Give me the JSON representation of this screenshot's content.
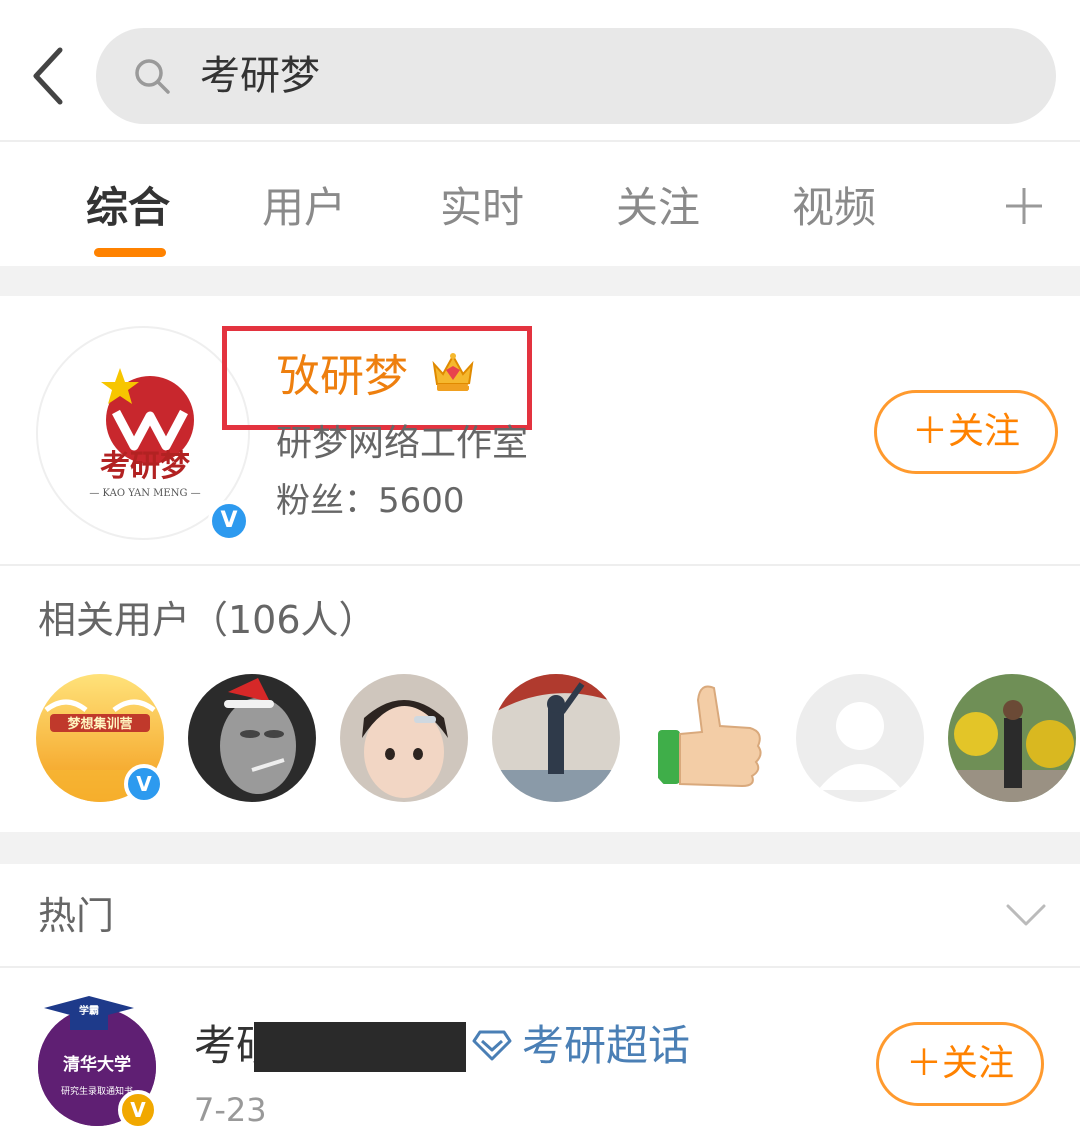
{
  "search": {
    "query": "考研梦"
  },
  "tabs": [
    {
      "label": "综合"
    },
    {
      "label": "用户"
    },
    {
      "label": "实时"
    },
    {
      "label": "关注"
    },
    {
      "label": "视频"
    }
  ],
  "user_card": {
    "name": "攷研梦",
    "description": "研梦网络工作室",
    "fans": "粉丝：5600",
    "follow_label": "＋关注",
    "avatar_logo_text": "考研梦",
    "avatar_logo_subtext": "— KAO YAN MENG —",
    "crown_level": "2"
  },
  "related": {
    "title": "相关用户（106人）",
    "first_avatar_banner": "梦想集训营"
  },
  "hot": {
    "title": "热门",
    "post": {
      "name_visible": "考研",
      "super_topic": "考研超话",
      "time": "7-23",
      "follow_label": "＋关注",
      "avatar_cap_text": "学霸",
      "avatar_school": "清华大学",
      "avatar_caption": "研究生录取通知书"
    }
  },
  "colors": {
    "accent": "#ff8200",
    "name_orange": "#ee7f0e",
    "highlight_red": "#e3333f",
    "verify_blue": "#2d9aef",
    "super_topic_blue": "#4a7fb5"
  }
}
